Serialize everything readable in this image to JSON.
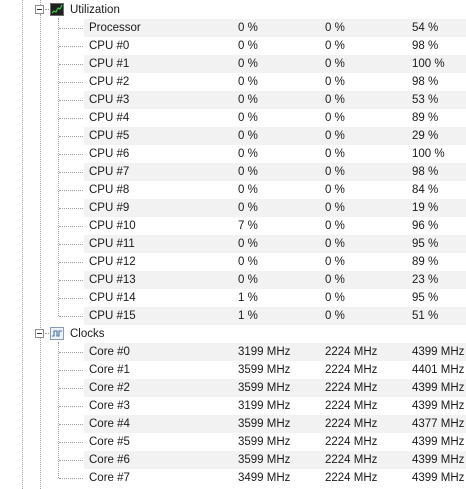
{
  "utilization": {
    "title": "Utilization",
    "icon": "utilization-graph-icon",
    "rows": [
      {
        "name": "Processor",
        "v1": "0 %",
        "v2": "0 %",
        "v3": "54 %"
      },
      {
        "name": "CPU #0",
        "v1": "0 %",
        "v2": "0 %",
        "v3": "98 %"
      },
      {
        "name": "CPU #1",
        "v1": "0 %",
        "v2": "0 %",
        "v3": "100 %"
      },
      {
        "name": "CPU #2",
        "v1": "0 %",
        "v2": "0 %",
        "v3": "98 %"
      },
      {
        "name": "CPU #3",
        "v1": "0 %",
        "v2": "0 %",
        "v3": "53 %"
      },
      {
        "name": "CPU #4",
        "v1": "0 %",
        "v2": "0 %",
        "v3": "89 %"
      },
      {
        "name": "CPU #5",
        "v1": "0 %",
        "v2": "0 %",
        "v3": "29 %"
      },
      {
        "name": "CPU #6",
        "v1": "0 %",
        "v2": "0 %",
        "v3": "100 %"
      },
      {
        "name": "CPU #7",
        "v1": "0 %",
        "v2": "0 %",
        "v3": "98 %"
      },
      {
        "name": "CPU #8",
        "v1": "0 %",
        "v2": "0 %",
        "v3": "84 %"
      },
      {
        "name": "CPU #9",
        "v1": "0 %",
        "v2": "0 %",
        "v3": "19 %"
      },
      {
        "name": "CPU #10",
        "v1": "7 %",
        "v2": "0 %",
        "v3": "96 %"
      },
      {
        "name": "CPU #11",
        "v1": "0 %",
        "v2": "0 %",
        "v3": "95 %"
      },
      {
        "name": "CPU #12",
        "v1": "0 %",
        "v2": "0 %",
        "v3": "89 %"
      },
      {
        "name": "CPU #13",
        "v1": "0 %",
        "v2": "0 %",
        "v3": "23 %"
      },
      {
        "name": "CPU #14",
        "v1": "1 %",
        "v2": "0 %",
        "v3": "95 %"
      },
      {
        "name": "CPU #15",
        "v1": "1 %",
        "v2": "0 %",
        "v3": "51 %"
      }
    ]
  },
  "clocks": {
    "title": "Clocks",
    "icon": "clock-wave-icon",
    "rows": [
      {
        "name": "Core #0",
        "v1": "3199 MHz",
        "v2": "2224 MHz",
        "v3": "4399 MHz"
      },
      {
        "name": "Core #1",
        "v1": "3599 MHz",
        "v2": "2224 MHz",
        "v3": "4401 MHz"
      },
      {
        "name": "Core #2",
        "v1": "3599 MHz",
        "v2": "2224 MHz",
        "v3": "4399 MHz"
      },
      {
        "name": "Core #3",
        "v1": "3199 MHz",
        "v2": "2224 MHz",
        "v3": "4399 MHz"
      },
      {
        "name": "Core #4",
        "v1": "3599 MHz",
        "v2": "2224 MHz",
        "v3": "4377 MHz"
      },
      {
        "name": "Core #5",
        "v1": "3599 MHz",
        "v2": "2224 MHz",
        "v3": "4399 MHz"
      },
      {
        "name": "Core #6",
        "v1": "3599 MHz",
        "v2": "2224 MHz",
        "v3": "4399 MHz"
      },
      {
        "name": "Core #7",
        "v1": "3499 MHz",
        "v2": "2224 MHz",
        "v3": "4399 MHz"
      }
    ]
  }
}
